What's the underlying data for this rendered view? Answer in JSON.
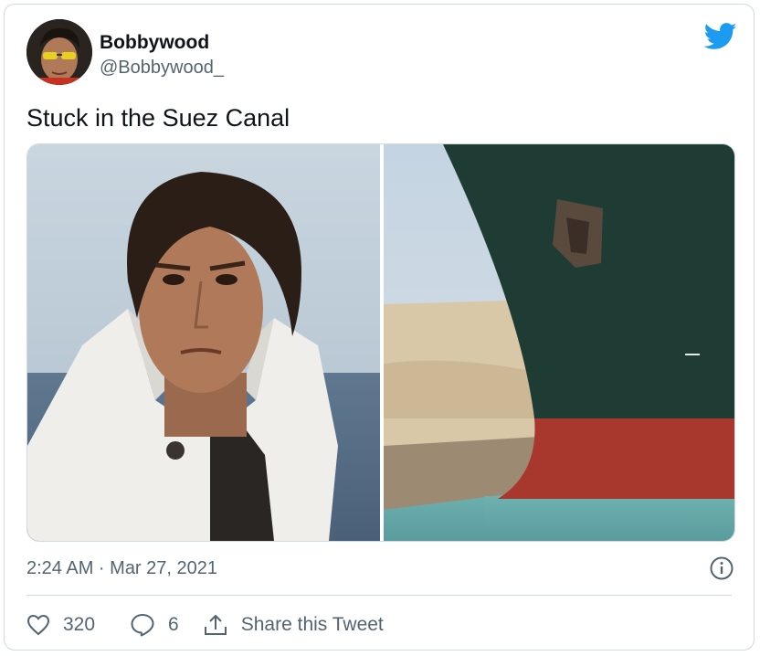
{
  "tweet": {
    "author": {
      "display_name": "Bobbywood",
      "handle": "@Bobbywood_"
    },
    "text": "Stuck in the Suez Canal",
    "timestamp": "2:24 AM · Mar 27, 2021",
    "actions": {
      "like_count": "320",
      "reply_count": "6",
      "share_label": "Share this Tweet"
    },
    "icons": {
      "brand": "twitter-bird-icon",
      "info": "info-icon",
      "like": "heart-icon",
      "reply": "reply-icon",
      "share": "share-icon"
    }
  },
  "colors": {
    "brand_blue": "#1d9bf0",
    "secondary_text": "#536471",
    "border": "#cfd9de"
  }
}
